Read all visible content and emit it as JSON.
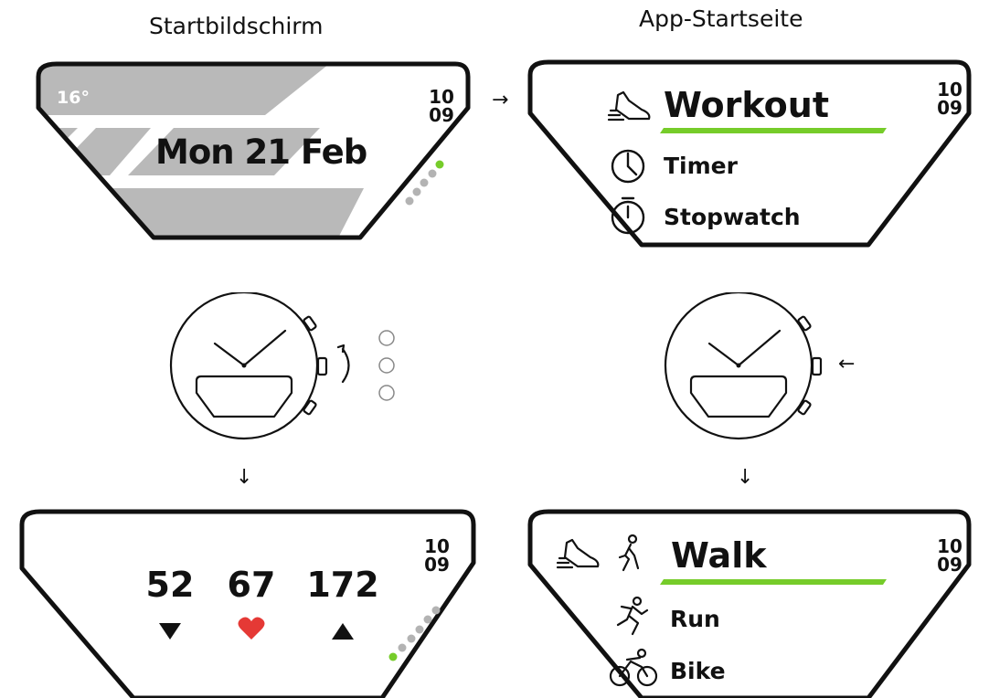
{
  "headings": {
    "left": "Startbildschirm",
    "right": "App-Startseite"
  },
  "home_screen": {
    "temperature": "16°",
    "date": "Mon 21 Feb",
    "time_hour": "10",
    "time_minute": "09"
  },
  "app_screen": {
    "time_hour": "10",
    "time_minute": "09",
    "items": [
      {
        "label": "Workout",
        "icon": "shoe-icon",
        "selected": true
      },
      {
        "label": "Timer",
        "icon": "clock-icon",
        "selected": false
      },
      {
        "label": "Stopwatch",
        "icon": "stopwatch-icon",
        "selected": false
      }
    ]
  },
  "hr_screen": {
    "time_hour": "10",
    "time_minute": "09",
    "values": [
      {
        "value": "52",
        "icon": "triangle-down-icon"
      },
      {
        "value": "67",
        "icon": "heart-icon"
      },
      {
        "value": "172",
        "icon": "triangle-up-icon"
      }
    ]
  },
  "workout_screen": {
    "time_hour": "10",
    "time_minute": "09",
    "items": [
      {
        "label": "Walk",
        "icon": "walk-icon",
        "selected": true
      },
      {
        "label": "Run",
        "icon": "run-icon",
        "selected": false
      },
      {
        "label": "Bike",
        "icon": "bike-icon",
        "selected": false
      }
    ]
  },
  "arrows": {
    "right": "→",
    "down_left": "↓",
    "down_right": "↓",
    "press": "←"
  },
  "colors": {
    "accent_green": "#76cc2a",
    "stripe_gray": "#b9b9b9",
    "heart_red": "#e53935",
    "dot_gray": "#b3b3b3"
  }
}
